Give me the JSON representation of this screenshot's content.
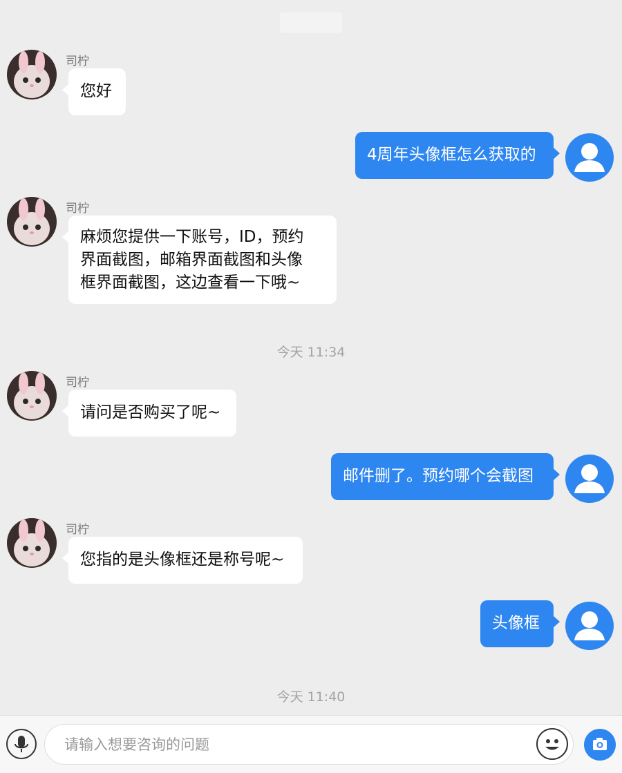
{
  "agent": {
    "name": "司柠"
  },
  "messages": [
    {
      "from": "agent",
      "text": "您好"
    },
    {
      "from": "user",
      "text": "4周年头像框怎么获取的"
    },
    {
      "from": "agent",
      "lines": [
        "麻烦您提供一下账号，ID，预约",
        "界面截图，邮箱界面截图和头像",
        "框界面截图，这边查看一下哦~"
      ]
    },
    {
      "from": "agent",
      "text": "请问是否购买了呢~"
    },
    {
      "from": "user",
      "text": "邮件删了。预约哪个会截图"
    },
    {
      "from": "agent",
      "text": "您指的是头像框还是称号呢~"
    },
    {
      "from": "user",
      "text": "头像框"
    }
  ],
  "timestamps": [
    "今天 11:34",
    "今天 11:40"
  ],
  "input": {
    "placeholder": "请输入想要咨询的问题"
  },
  "colors": {
    "background": "#ededed",
    "user_bubble": "#2e86f0",
    "agent_bubble": "#ffffff",
    "timestamp": "#a3a3a3"
  },
  "icons": {
    "voice": "microphone-icon",
    "emoji": "smiley-icon",
    "camera": "camera-icon",
    "user_avatar": "user-silhouette-icon",
    "agent_avatar": "cat-avatar"
  }
}
